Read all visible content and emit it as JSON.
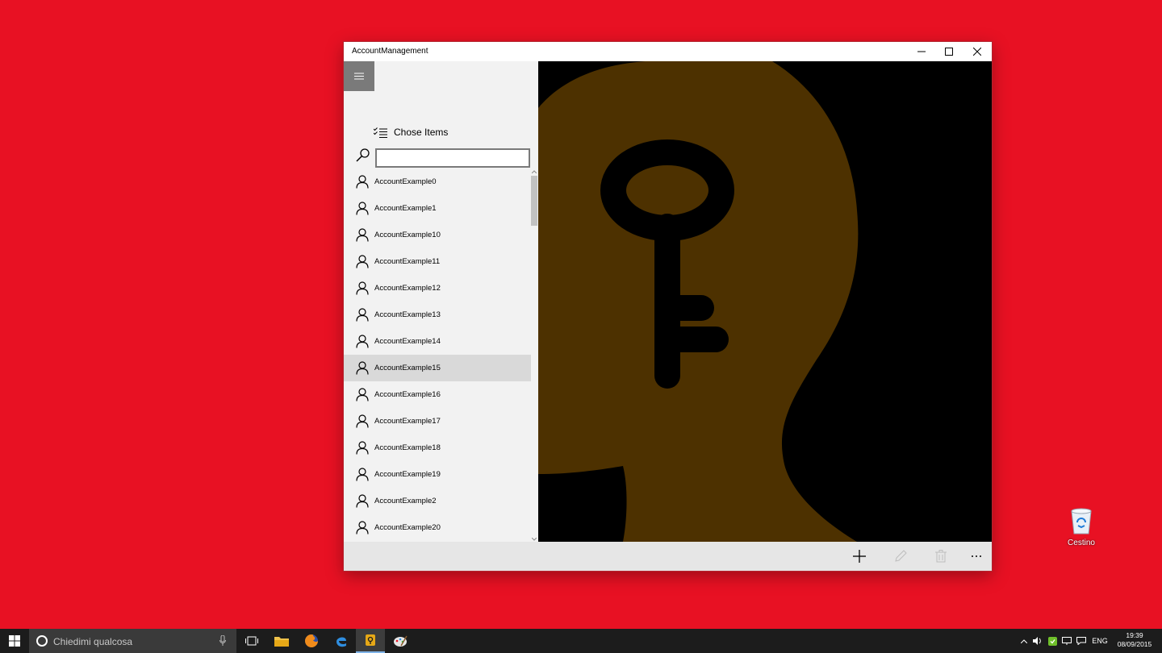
{
  "window": {
    "title": "AccountManagement"
  },
  "pane": {
    "chose_label": "Chose Items",
    "search_value": "",
    "items": [
      {
        "label": "AccountExample0",
        "selected": false
      },
      {
        "label": "AccountExample1",
        "selected": false
      },
      {
        "label": "AccountExample10",
        "selected": false
      },
      {
        "label": "AccountExample11",
        "selected": false
      },
      {
        "label": "AccountExample12",
        "selected": false
      },
      {
        "label": "AccountExample13",
        "selected": false
      },
      {
        "label": "AccountExample14",
        "selected": false
      },
      {
        "label": "AccountExample15",
        "selected": true
      },
      {
        "label": "AccountExample16",
        "selected": false
      },
      {
        "label": "AccountExample17",
        "selected": false
      },
      {
        "label": "AccountExample18",
        "selected": false
      },
      {
        "label": "AccountExample19",
        "selected": false
      },
      {
        "label": "AccountExample2",
        "selected": false
      },
      {
        "label": "AccountExample20",
        "selected": false
      }
    ]
  },
  "image": {
    "head_color": "#4d3100",
    "background_color": "#000000"
  },
  "commandbar": {
    "icons": [
      "add-icon",
      "edit-icon",
      "delete-icon",
      "more-icon"
    ]
  },
  "desktop": {
    "recycle_bin_label": "Cestino"
  },
  "taskbar": {
    "search_placeholder": "Chiedimi qualcosa",
    "language": "ENG",
    "time": "19:39",
    "date": "08/09/2015"
  },
  "colors": {
    "desktop": "#e81123",
    "taskbar": "#1c1c1c",
    "selection": "#d9d9d9"
  }
}
